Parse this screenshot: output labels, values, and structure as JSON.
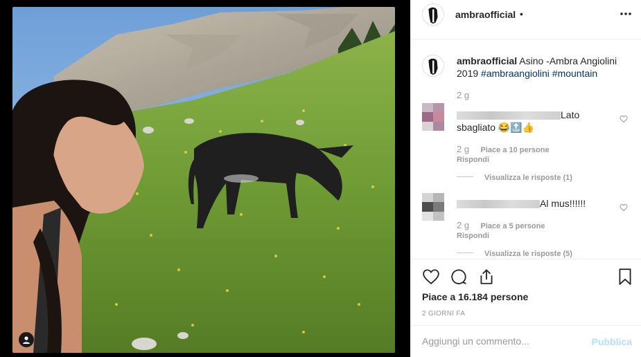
{
  "post": {
    "username": "ambraofficial",
    "dot": "•",
    "more_icon": "more-horizontal-icon"
  },
  "caption": {
    "username": "ambraofficial",
    "text": "Asino -Ambra Angiolini 2019",
    "hashtags": [
      "#ambraangiolini",
      "#mountain"
    ],
    "age": "2 g"
  },
  "comments": [
    {
      "text_suffix": "Lato",
      "text_line2": "sbagliato 😂🔝👍",
      "age": "2 g",
      "likes": "Piace a 10 persone",
      "reply": "Rispondi",
      "view_replies": "Visualizza le risposte (1)"
    },
    {
      "text_suffix": "Al mus!!!!!!",
      "age": "2 g",
      "likes": "Piace a 5 persone",
      "reply": "Rispondi",
      "view_replies": "Visualizza le risposte (5)"
    }
  ],
  "footer": {
    "likes": "Piace a 16.184 persone",
    "time": "2 GIORNI FA",
    "comment_placeholder": "Aggiungi un commento...",
    "publish": "Pubblica"
  },
  "colors": {
    "link": "#003569",
    "publish_disabled": "#b2dffc",
    "text": "#262626",
    "muted": "#999999"
  }
}
